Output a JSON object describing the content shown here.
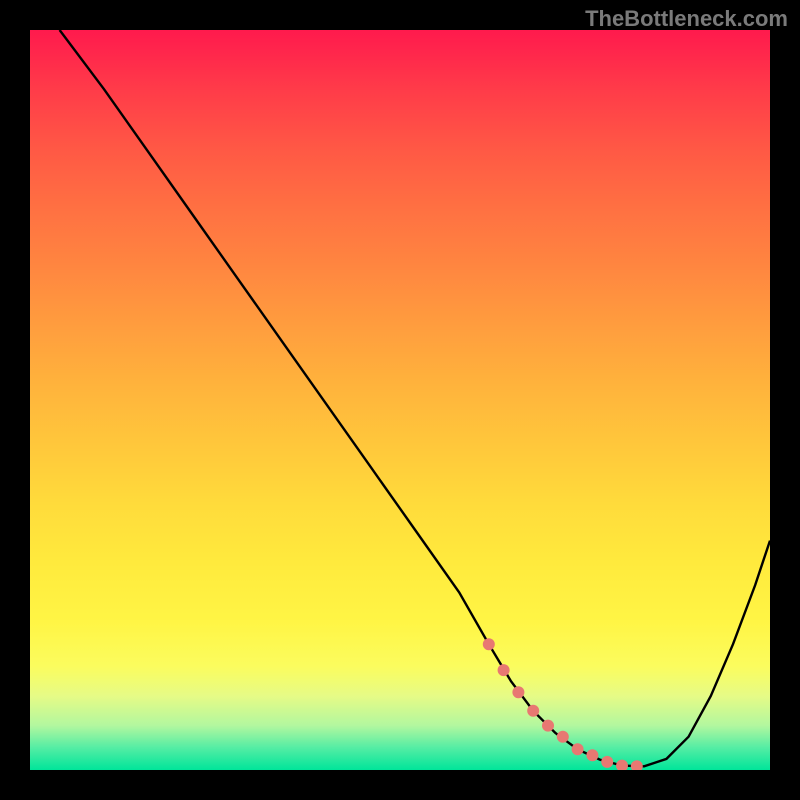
{
  "watermark": "TheBottleneck.com",
  "chart_data": {
    "type": "line",
    "title": "",
    "xlabel": "",
    "ylabel": "",
    "xlim": [
      0,
      100
    ],
    "ylim": [
      0,
      100
    ],
    "background": "rainbow-gradient-vertical",
    "series": [
      {
        "name": "bottleneck-curve",
        "x": [
          4,
          10,
          16,
          22,
          28,
          34,
          40,
          46,
          52,
          58,
          62,
          65,
          68,
          71,
          74,
          77,
          80,
          83,
          86,
          89,
          92,
          95,
          98,
          100
        ],
        "values": [
          100,
          92,
          83.5,
          75,
          66.5,
          58,
          49.5,
          41,
          32.5,
          24,
          17,
          12,
          8,
          5,
          2.8,
          1.4,
          0.6,
          0.5,
          1.5,
          4.5,
          10,
          17,
          25,
          31
        ]
      }
    ],
    "markers": {
      "name": "highlight-dots",
      "color": "#e87872",
      "x": [
        62,
        64,
        66,
        68,
        70,
        72,
        74,
        76,
        78,
        80,
        82
      ],
      "values": [
        17,
        13.5,
        10.5,
        8,
        6,
        4.5,
        2.8,
        2,
        1.1,
        0.6,
        0.5
      ]
    }
  }
}
